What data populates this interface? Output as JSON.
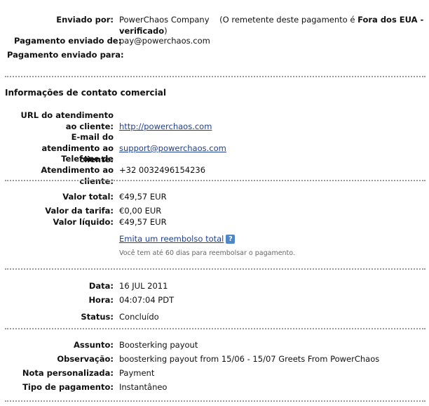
{
  "sender": {
    "sent_by_label": "Enviado por:",
    "sender_name": "PowerChaos Company",
    "sender_note_prefix": "(O remetente deste pagamento é",
    "sender_note_bold": "Fora dos EUA - verificado",
    "sender_note_suffix": ")",
    "payment_sent_from_label": "Pagamento enviado de:",
    "payment_sent_from_value": "pay@powerchaos.com",
    "payment_sent_to_label": "Pagamento enviado para:",
    "payment_sent_to_value": ""
  },
  "contact": {
    "section_title": "Informações de contato comercial",
    "support_url_label": "URL do atendimento ao cliente:",
    "support_url_value": "http://powerchaos.com",
    "support_email_label": "E-mail do atendimento ao cliente:",
    "support_email_value": "support@powerchaos.com",
    "support_phone_label": "Telefone de Atendimento ao cliente:",
    "support_phone_value": "+32 0032496154236"
  },
  "amounts": {
    "total_label": "Valor total:",
    "total_value": "€49,57 EUR",
    "fee_label": "Valor da tarifa:",
    "fee_value": "€0,00 EUR",
    "net_label": "Valor líquido:",
    "net_value": "€49,57 EUR",
    "refund_link": "Emita um reembolso total",
    "help_icon": "?",
    "refund_note": "Você tem até 60 dias para reembolsar o pagamento."
  },
  "transaction": {
    "date_label": "Data:",
    "date_value": "16 JUL 2011",
    "time_label": "Hora:",
    "time_value": "04:07:04 PDT",
    "status_label": "Status:",
    "status_value": "Concluído"
  },
  "details": {
    "subject_label": "Assunto:",
    "subject_value": "Boosterking payout",
    "observation_label": "Observação:",
    "observation_value": "boosterking payout from 15/06 - 15/07 Greets From PowerChaos",
    "custom_note_label": "Nota personalizada:",
    "custom_note_value": "Payment",
    "payment_type_label": "Tipo de pagamento:",
    "payment_type_value": "Instantâneo"
  }
}
